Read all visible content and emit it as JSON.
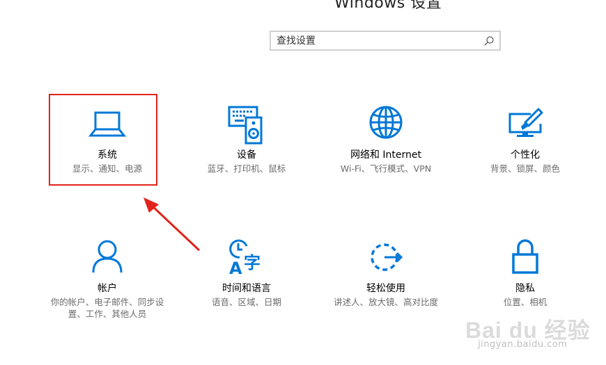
{
  "window": {
    "title": "Windows 设置"
  },
  "search": {
    "placeholder": "查找设置"
  },
  "colors": {
    "accent": "#0078d7",
    "highlight": "#e2231a"
  },
  "tiles": [
    {
      "icon": "laptop-icon",
      "title": "系统",
      "desc": "显示、通知、电源"
    },
    {
      "icon": "keyboard-speaker-icon",
      "title": "设备",
      "desc": "蓝牙、打印机、鼠标"
    },
    {
      "icon": "globe-icon",
      "title": "网络和 Internet",
      "desc": "Wi-Fi、飞行模式、VPN"
    },
    {
      "icon": "paintbrush-monitor-icon",
      "title": "个性化",
      "desc": "背景、锁屏、颜色"
    },
    {
      "icon": "person-icon",
      "title": "帐户",
      "desc": "你的帐户、电子邮件、同步设置、工作、其他人员"
    },
    {
      "icon": "clock-language-icon",
      "title": "时间和语言",
      "desc": "语音、区域、日期"
    },
    {
      "icon": "ease-of-access-icon",
      "title": "轻松使用",
      "desc": "讲述人、放大镜、高对比度"
    },
    {
      "icon": "lock-icon",
      "title": "隐私",
      "desc": "位置、相机"
    }
  ],
  "watermark": {
    "brand": "Bai du 经验",
    "url": "jingyan.baidu.com"
  }
}
